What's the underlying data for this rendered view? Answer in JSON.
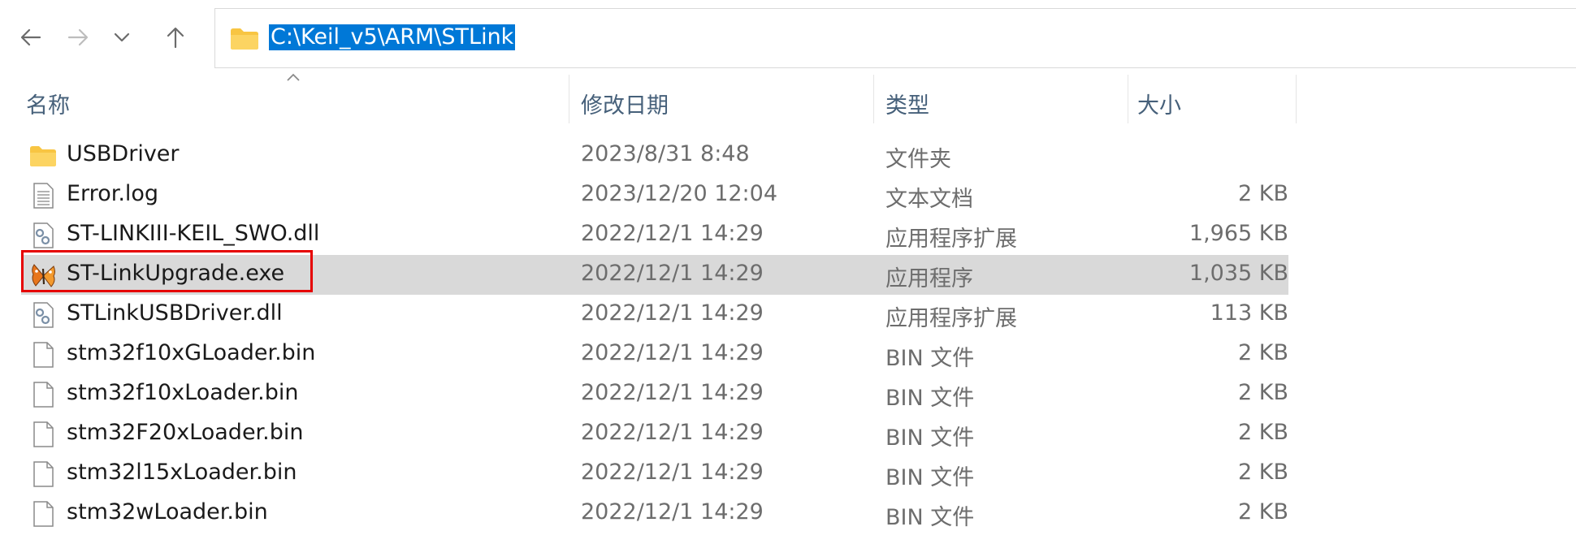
{
  "nav": {
    "back_icon": "arrow-left-icon",
    "forward_icon": "arrow-right-icon",
    "recent_icon": "chevron-down-icon",
    "up_icon": "arrow-up-icon"
  },
  "address_bar": {
    "path": "C:\\Keil_v5\\ARM\\STLink",
    "folder_icon": "folder-icon",
    "selection_color": "#0078d7"
  },
  "columns": {
    "name": "名称",
    "date": "修改日期",
    "type": "类型",
    "size": "大小"
  },
  "files": [
    {
      "name": "USBDriver",
      "date": "2023/8/31 8:48",
      "type": "文件夹",
      "size": "",
      "icon": "folder-icon"
    },
    {
      "name": "Error.log",
      "date": "2023/12/20 12:04",
      "type": "文本文档",
      "size": "2 KB",
      "icon": "text-file-icon"
    },
    {
      "name": "ST-LINKIII-KEIL_SWO.dll",
      "date": "2022/12/1 14:29",
      "type": "应用程序扩展",
      "size": "1,965 KB",
      "icon": "dll-file-icon"
    },
    {
      "name": "ST-LinkUpgrade.exe",
      "date": "2022/12/1 14:29",
      "type": "应用程序",
      "size": "1,035 KB",
      "icon": "butterfly-app-icon",
      "selected": true,
      "highlighted": true
    },
    {
      "name": "STLinkUSBDriver.dll",
      "date": "2022/12/1 14:29",
      "type": "应用程序扩展",
      "size": "113 KB",
      "icon": "dll-file-icon"
    },
    {
      "name": "stm32f10xGLoader.bin",
      "date": "2022/12/1 14:29",
      "type": "BIN 文件",
      "size": "2 KB",
      "icon": "blank-file-icon"
    },
    {
      "name": "stm32f10xLoader.bin",
      "date": "2022/12/1 14:29",
      "type": "BIN 文件",
      "size": "2 KB",
      "icon": "blank-file-icon"
    },
    {
      "name": "stm32F20xLoader.bin",
      "date": "2022/12/1 14:29",
      "type": "BIN 文件",
      "size": "2 KB",
      "icon": "blank-file-icon"
    },
    {
      "name": "stm32l15xLoader.bin",
      "date": "2022/12/1 14:29",
      "type": "BIN 文件",
      "size": "2 KB",
      "icon": "blank-file-icon"
    },
    {
      "name": "stm32wLoader.bin",
      "date": "2022/12/1 14:29",
      "type": "BIN 文件",
      "size": "2 KB",
      "icon": "blank-file-icon"
    }
  ],
  "colors": {
    "selected_row": "#d9d9d9",
    "highlight_border": "#e60000",
    "header_text": "#46607a"
  }
}
